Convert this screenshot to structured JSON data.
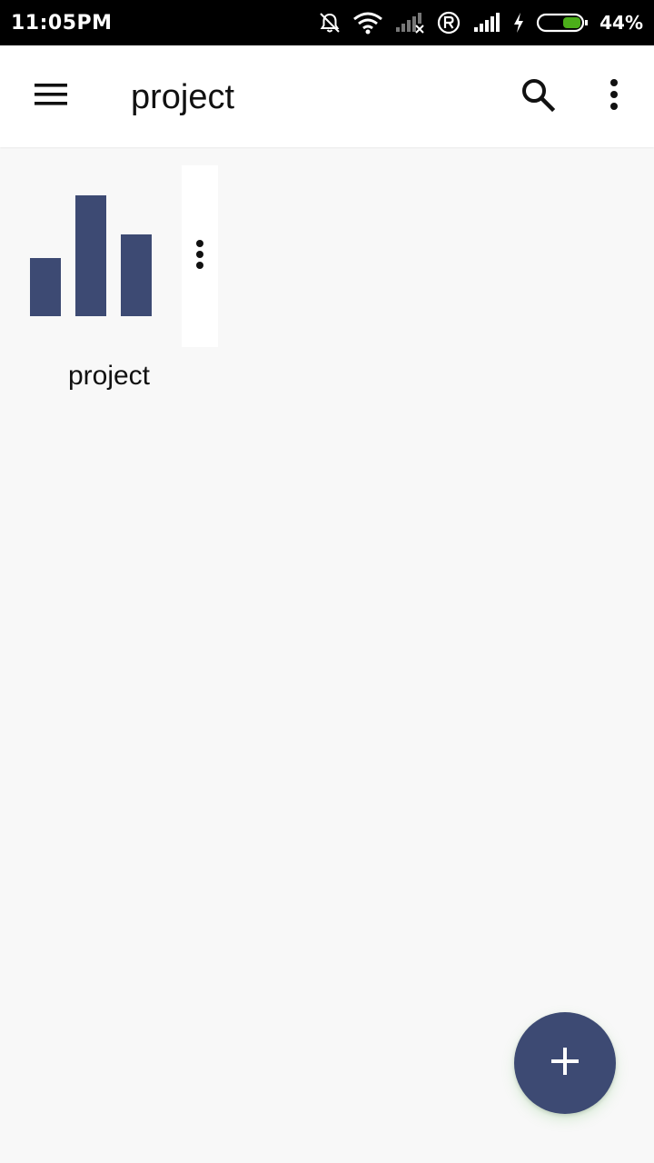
{
  "status_bar": {
    "time": "11:05PM",
    "battery_percent": "44%",
    "icons": [
      "bell-off-icon",
      "wifi-icon",
      "signal-no-service-icon",
      "roaming-r-icon",
      "signal-full-icon",
      "charging-bolt-icon",
      "battery-icon"
    ],
    "battery_level": 0.44,
    "battery_color": "#4caf1a"
  },
  "app_bar": {
    "title": "project",
    "icons": [
      "menu-icon",
      "search-icon",
      "more-vert-icon"
    ]
  },
  "projects": [
    {
      "label": "project",
      "thumbnail_icon": "bar-chart-icon",
      "thumbnail_bar_heights": [
        0.48,
        1.0,
        0.68
      ],
      "more_icon": "more-vert-icon"
    }
  ],
  "fab": {
    "icon": "add-icon"
  },
  "colors": {
    "accent": "#3d4a73",
    "background": "#f8f8f8",
    "app_bar": "#ffffff",
    "status_bar": "#000000"
  }
}
